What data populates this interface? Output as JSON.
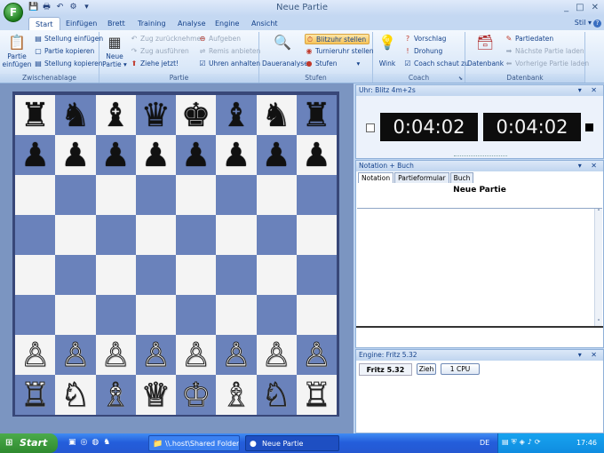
{
  "window": {
    "title": "Neue Partie",
    "controls": [
      "_",
      "□",
      "✕"
    ]
  },
  "app_orb": {
    "glyph": "F"
  },
  "quick_access": [
    {
      "name": "save-icon",
      "glyph": "💾"
    },
    {
      "name": "print-icon",
      "glyph": "🖶"
    },
    {
      "name": "undo-icon",
      "glyph": "↶"
    },
    {
      "name": "settings-icon",
      "glyph": "⚙"
    },
    {
      "name": "qat-dropdown-icon",
      "glyph": "▾"
    }
  ],
  "tabs": [
    "Start",
    "Einfügen",
    "Brett",
    "Training",
    "Analyse",
    "Engine",
    "Ansicht"
  ],
  "active_tab": "Start",
  "style_menu": "Stil ▾",
  "help_glyph": "?",
  "ribbon": {
    "zwischenablage": {
      "label": "Zwischenablage",
      "paste_label_1": "Partie",
      "paste_label_2": "einfügen",
      "items": [
        "Stellung einfügen",
        "Partie kopieren",
        "Stellung kopieren"
      ]
    },
    "partie": {
      "label": "Partie",
      "new_label_1": "Neue",
      "new_label_2": "Partie ▾",
      "items": [
        "Zug zurücknehmen",
        "Zug ausführen",
        "Ziehe jetzt!",
        "Aufgeben",
        "Remis anbieten",
        "Uhren anhalten"
      ]
    },
    "stufen": {
      "label": "Stufen",
      "analysis_label": "Daueranalyse",
      "items": [
        "Blitzuhr stellen",
        "Turnieruhr stellen",
        "Stufen"
      ]
    },
    "coach": {
      "label": "Coach",
      "wink_label": "Wink",
      "items": [
        "Vorschlag",
        "Drohung",
        "Coach schaut zu"
      ]
    },
    "datenbank": {
      "label": "Datenbank",
      "db_label": "Datenbank",
      "items": [
        "Partiedaten",
        "Nächste Partie laden",
        "Vorherige Partie laden"
      ]
    }
  },
  "board": {
    "rows": [
      [
        "♜",
        "♞",
        "♝",
        "♛",
        "♚",
        "♝",
        "♞",
        "♜"
      ],
      [
        "♟",
        "♟",
        "♟",
        "♟",
        "♟",
        "♟",
        "♟",
        "♟"
      ],
      [
        "",
        "",
        "",
        "",
        "",
        "",
        "",
        ""
      ],
      [
        "",
        "",
        "",
        "",
        "",
        "",
        "",
        ""
      ],
      [
        "",
        "",
        "",
        "",
        "",
        "",
        "",
        ""
      ],
      [
        "",
        "",
        "",
        "",
        "",
        "",
        "",
        ""
      ],
      [
        "♙",
        "♙",
        "♙",
        "♙",
        "♙",
        "♙",
        "♙",
        "♙"
      ],
      [
        "♖",
        "♘",
        "♗",
        "♕",
        "♔",
        "♗",
        "♘",
        "♖"
      ]
    ]
  },
  "clock_pane": {
    "header": "Uhr: Blitz 4m+2s",
    "white_time": "0:04:02",
    "black_time": "0:04:02"
  },
  "notation_pane": {
    "header": "Notation + Buch",
    "tabs": [
      "Notation",
      "Partieformular",
      "Buch"
    ],
    "title": "Neue Partie"
  },
  "engine_pane": {
    "header": "Engine: Fritz 5.32",
    "engine_name": "Fritz 5.32",
    "move_button": "Zieh",
    "cpu_button": "1 CPU"
  },
  "pane_buttons": "▾ ✕",
  "taskbar": {
    "start": "Start",
    "folder_task": "\\\\.host\\Shared Folder...",
    "game_task": "Neue Partie",
    "language": "DE",
    "time": "17:46"
  }
}
